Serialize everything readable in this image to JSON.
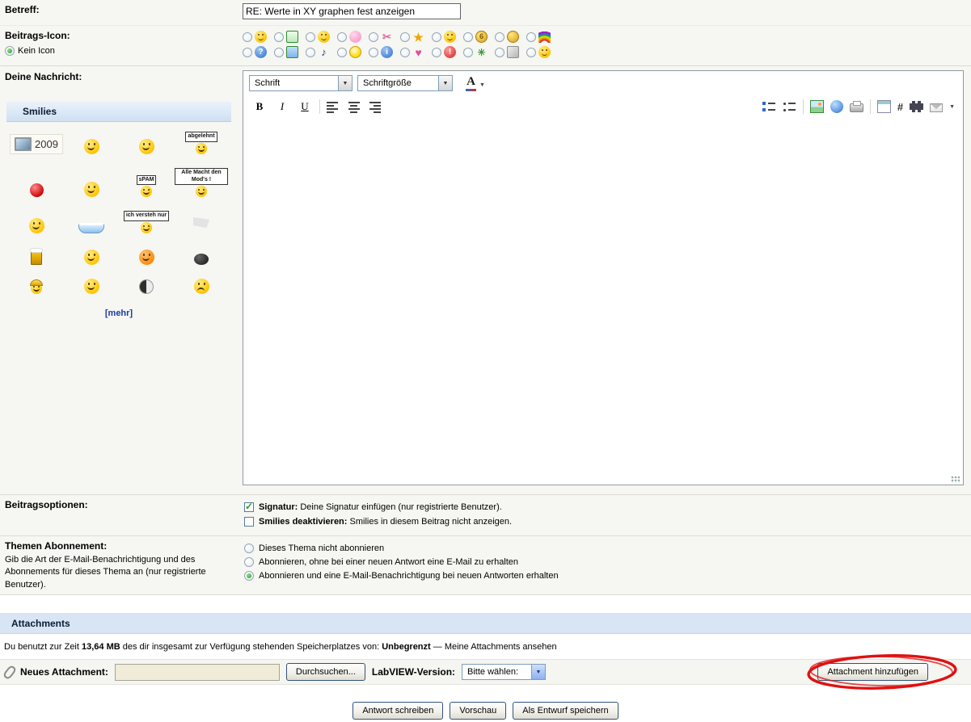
{
  "subject": {
    "label": "Betreff:",
    "value": "RE: Werte in XY graphen fest anzeigen"
  },
  "post_icon": {
    "label": "Beitrags-Icon:",
    "no_icon_label": "Kein Icon",
    "rows": [
      [
        {
          "name": "laugh-smiley-icon",
          "style": "smiley",
          "char": ""
        },
        {
          "name": "chart-icon",
          "style": "greensq",
          "char": ""
        },
        {
          "name": "grin-smiley-icon",
          "style": "smiley",
          "char": ""
        },
        {
          "name": "thumb-icon",
          "style": "pink",
          "char": ""
        },
        {
          "name": "scissors-icon",
          "style": "scissors",
          "char": "✂"
        },
        {
          "name": "star-icon",
          "style": "star",
          "char": "★"
        },
        {
          "name": "wink-smiley-icon",
          "style": "smiley",
          "char": ""
        },
        {
          "name": "gold-coin-icon",
          "style": "gold",
          "char": "6"
        },
        {
          "name": "coin-icon",
          "style": "gold",
          "char": ""
        },
        {
          "name": "rainbow-icon",
          "style": "rainbow",
          "char": ""
        }
      ],
      [
        {
          "name": "question-icon",
          "style": "blue",
          "char": "?"
        },
        {
          "name": "screen-icon",
          "style": "screen",
          "char": ""
        },
        {
          "name": "music-note-icon",
          "style": "music",
          "char": "♪"
        },
        {
          "name": "bulb-icon",
          "style": "bulb",
          "char": ""
        },
        {
          "name": "info-icon",
          "style": "blue",
          "char": "i"
        },
        {
          "name": "heart-icon",
          "style": "heart",
          "char": "♥"
        },
        {
          "name": "exclamation-icon",
          "style": "red",
          "char": "!"
        },
        {
          "name": "virus-icon",
          "style": "virus",
          "char": "✳"
        },
        {
          "name": "brick-icon",
          "style": "brick",
          "char": ""
        },
        {
          "name": "halo-smiley-icon",
          "style": "smiley",
          "char": ""
        }
      ]
    ]
  },
  "message": {
    "label": "Deine Nachricht:"
  },
  "smilies": {
    "title": "Smilies",
    "more_label": "[mehr]",
    "items": [
      {
        "name": "computer-2009-smiley",
        "kind": "computer",
        "label": "2009"
      },
      {
        "name": "wink-smiley",
        "kind": "smiley"
      },
      {
        "name": "laugh-smiley",
        "kind": "smiley"
      },
      {
        "name": "abgelehnt-sign-smiley",
        "kind": "sign",
        "label": "abgelehnt"
      },
      {
        "name": "red-ball-smiley",
        "kind": "ball"
      },
      {
        "name": "cheer-smiley",
        "kind": "smiley"
      },
      {
        "name": "spam-sign-smiley",
        "kind": "sign",
        "label": "sPAM"
      },
      {
        "name": "mods-sign-smiley",
        "kind": "sign",
        "label": "Alle Macht den Mod's !"
      },
      {
        "name": "talk-smiley",
        "kind": "smiley"
      },
      {
        "name": "bathtub-smiley",
        "kind": "tub"
      },
      {
        "name": "bahnhof-sign-smiley",
        "kind": "sign",
        "label": "ich versteh nur"
      },
      {
        "name": "sail-smiley",
        "kind": "flag"
      },
      {
        "name": "beer-smiley",
        "kind": "beer"
      },
      {
        "name": "tongue-smiley",
        "kind": "smiley"
      },
      {
        "name": "cool-smiley",
        "kind": "orange"
      },
      {
        "name": "bomb-smiley",
        "kind": "bomb"
      },
      {
        "name": "builder-smiley",
        "kind": "worker"
      },
      {
        "name": "grin-smiley",
        "kind": "smiley"
      },
      {
        "name": "moon-smiley",
        "kind": "moon"
      },
      {
        "name": "angry-smiley",
        "kind": "angry"
      }
    ]
  },
  "editor": {
    "font_select_label": "Schrift",
    "size_select_label": "Schriftgröße",
    "color_button_label": "A",
    "bold_label": "B",
    "italic_label": "I",
    "underline_label": "U",
    "code_label": "#"
  },
  "post_options": {
    "label": "Beitragsoptionen:",
    "options": [
      {
        "checked": true,
        "title": "Signatur:",
        "text": "Deine Signatur einfügen (nur registrierte Benutzer)."
      },
      {
        "checked": false,
        "title": "Smilies deaktivieren:",
        "text": "Smilies in diesem Beitrag nicht anzeigen."
      }
    ]
  },
  "subscription": {
    "label": "Themen Abonnement:",
    "description": "Gib die Art der E-Mail-Benachrichtigung und des Abonnements für dieses Thema an (nur registrierte Benutzer).",
    "options": [
      {
        "selected": false,
        "text": "Dieses Thema nicht abonnieren"
      },
      {
        "selected": false,
        "text": "Abonnieren, ohne bei einer neuen Antwort eine E-Mail zu erhalten"
      },
      {
        "selected": true,
        "text": "Abonnieren und eine E-Mail-Benachrichtigung bei neuen Antworten erhalten"
      }
    ]
  },
  "attachments": {
    "header": "Attachments",
    "usage": {
      "prefix": "Du benutzt zur Zeit ",
      "amount": "13,64 MB",
      "middle": " des dir insgesamt zur Verfügung stehenden Speicherplatzes von: ",
      "limit": "Unbegrenzt",
      "separator": " — ",
      "link": "Meine Attachments ansehen"
    },
    "new_label": "Neues Attachment:",
    "file_input_value": "",
    "browse_button": "Durchsuchen...",
    "labview_label": "LabVIEW-Version:",
    "version_value": "Bitte wählen:",
    "add_button": "Attachment hinzufügen"
  },
  "footer": {
    "submit_button": "Antwort schreiben",
    "preview_button": "Vorschau",
    "draft_button": "Als Entwurf speichern"
  },
  "colors": {
    "section_header_blue": "#d7e5f4",
    "annotation_red": "#e01010",
    "row_background": "#f6f6f2"
  }
}
